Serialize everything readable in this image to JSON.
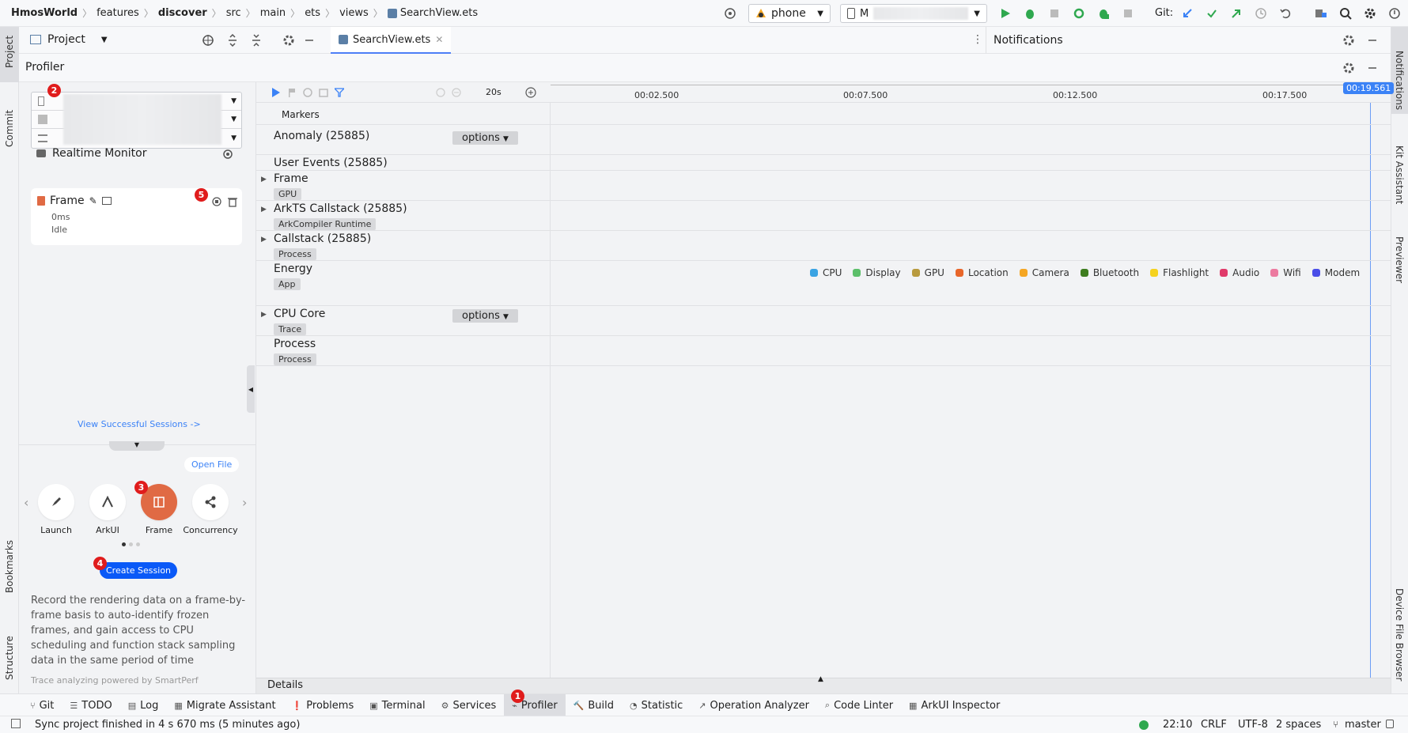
{
  "breadcrumb": [
    "HmosWorld",
    "features",
    "discover",
    "src",
    "main",
    "ets",
    "views"
  ],
  "breadcrumb_file": "SearchView.ets",
  "toolbar": {
    "device_select": "phone",
    "target_select": "M",
    "git_label": "Git:"
  },
  "project_panel": {
    "label": "Project"
  },
  "editor_tab": {
    "label": "SearchView.ets"
  },
  "notifications": {
    "label": "Notifications"
  },
  "profiler": {
    "title": "Profiler"
  },
  "left_strip": {
    "project": "Project",
    "commit": "Commit",
    "bookmarks": "Bookmarks",
    "structure": "Structure"
  },
  "right_strip": {
    "notifications": "Notifications",
    "kit_assistant": "Kit Assistant",
    "previewer": "Previewer",
    "device_file_browser": "Device File Browser"
  },
  "realtime_monitor": {
    "label": "Realtime Monitor"
  },
  "session": {
    "name": "Frame",
    "duration": "0ms",
    "status": "Idle"
  },
  "view_sessions": "View Successful Sessions ->",
  "open_file": "Open File",
  "templates": [
    {
      "label": "Launch",
      "icon": "rocket-icon"
    },
    {
      "label": "ArkUI",
      "icon": "arkui-icon"
    },
    {
      "label": "Frame",
      "icon": "frame-icon"
    },
    {
      "label": "Concurrency",
      "icon": "concurrency-icon"
    }
  ],
  "create_session": "Create Session",
  "description": "Record the rendering data on a frame-by-frame basis to auto-identify frozen frames, and gain access to CPU scheduling and function stack sampling data in the same period of time",
  "powered_by": "Trace analyzing powered by SmartPerf",
  "badges": [
    "1",
    "2",
    "3",
    "4",
    "5"
  ],
  "timeline": {
    "duration": "20s",
    "ticks": [
      "00:02.500",
      "00:07.500",
      "00:12.500",
      "00:17.500"
    ],
    "current_time": "00:19.561",
    "markers_label": "Markers",
    "options_label": "options",
    "rows": [
      {
        "label": "Anomaly (25885)",
        "tag": ""
      },
      {
        "label": "User Events (25885)",
        "tag": ""
      },
      {
        "label": "Frame",
        "tag": "GPU"
      },
      {
        "label": "ArkTS Callstack (25885)",
        "tag": "ArkCompiler Runtime"
      },
      {
        "label": "Callstack (25885)",
        "tag": "Process"
      },
      {
        "label": "Energy",
        "tag": "App"
      },
      {
        "label": "CPU Core",
        "tag": "Trace"
      },
      {
        "label": "Process",
        "tag": "Process"
      }
    ],
    "energy_legend": [
      {
        "name": "CPU",
        "color": "#3aa3e3"
      },
      {
        "name": "Display",
        "color": "#5cbf6a"
      },
      {
        "name": "GPU",
        "color": "#b89a3e"
      },
      {
        "name": "Location",
        "color": "#e8662a"
      },
      {
        "name": "Camera",
        "color": "#f5a623"
      },
      {
        "name": "Bluetooth",
        "color": "#3e7d1f"
      },
      {
        "name": "Flashlight",
        "color": "#f5d21f"
      },
      {
        "name": "Audio",
        "color": "#e03a6a"
      },
      {
        "name": "Wifi",
        "color": "#ec7aa0"
      },
      {
        "name": "Modem",
        "color": "#4a4ee8"
      }
    ]
  },
  "details": "Details",
  "bottom_tools": [
    "Git",
    "TODO",
    "Log",
    "Migrate Assistant",
    "Problems",
    "Terminal",
    "Services",
    "Profiler",
    "Build",
    "Statistic",
    "Operation Analyzer",
    "Code Linter",
    "ArkUI Inspector"
  ],
  "status": {
    "message": "Sync project finished in 4 s 670 ms (5 minutes ago)",
    "time": "22:10",
    "line_sep": "CRLF",
    "encoding": "UTF-8",
    "indent": "2 spaces",
    "branch": "master"
  }
}
